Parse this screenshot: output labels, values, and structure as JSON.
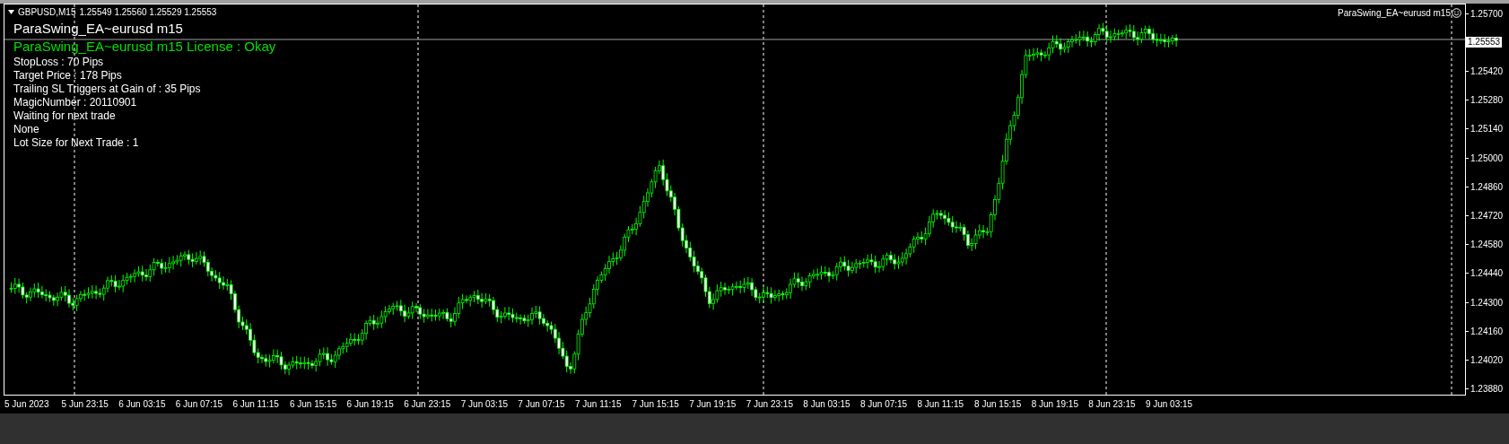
{
  "symbol_bar": {
    "symbol": "GBPUSD,M15",
    "quote": "1.25549 1.25560 1.25529 1.25553"
  },
  "ea_title": "ParaSwing_EA~eurusd m15",
  "license_line": "ParaSwing_EA~eurusd m15 License : Okay",
  "info_lines": [
    "StopLoss : 70 Pips",
    "Target Price : 178 Pips",
    "Trailing SL Triggers at Gain of : 35 Pips",
    "MagicNumber : 20110901",
    "Waiting for next trade",
    "None",
    "Lot Size for Next Trade : 1"
  ],
  "corner_label": "ParaSwing_EA~eurusd m15",
  "price_axis": {
    "ticks": [
      "1.25700",
      "1.25420",
      "1.25280",
      "1.25140",
      "1.25000",
      "1.24860",
      "1.24720",
      "1.24580",
      "1.24440",
      "1.24300",
      "1.24160",
      "1.24020",
      "1.23880"
    ],
    "current_price": "1.25553"
  },
  "time_axis": {
    "labels": [
      "5 Jun 2023",
      "5 Jun 23:15",
      "6 Jun 03:15",
      "6 Jun 07:15",
      "6 Jun 11:15",
      "6 Jun 15:15",
      "6 Jun 19:15",
      "6 Jun 23:15",
      "7 Jun 03:15",
      "7 Jun 07:15",
      "7 Jun 11:15",
      "7 Jun 15:15",
      "7 Jun 19:15",
      "7 Jun 23:15",
      "8 Jun 03:15",
      "8 Jun 07:15",
      "8 Jun 11:15",
      "8 Jun 15:15",
      "8 Jun 19:15",
      "8 Jun 23:15",
      "9 Jun 03:15"
    ]
  }
}
